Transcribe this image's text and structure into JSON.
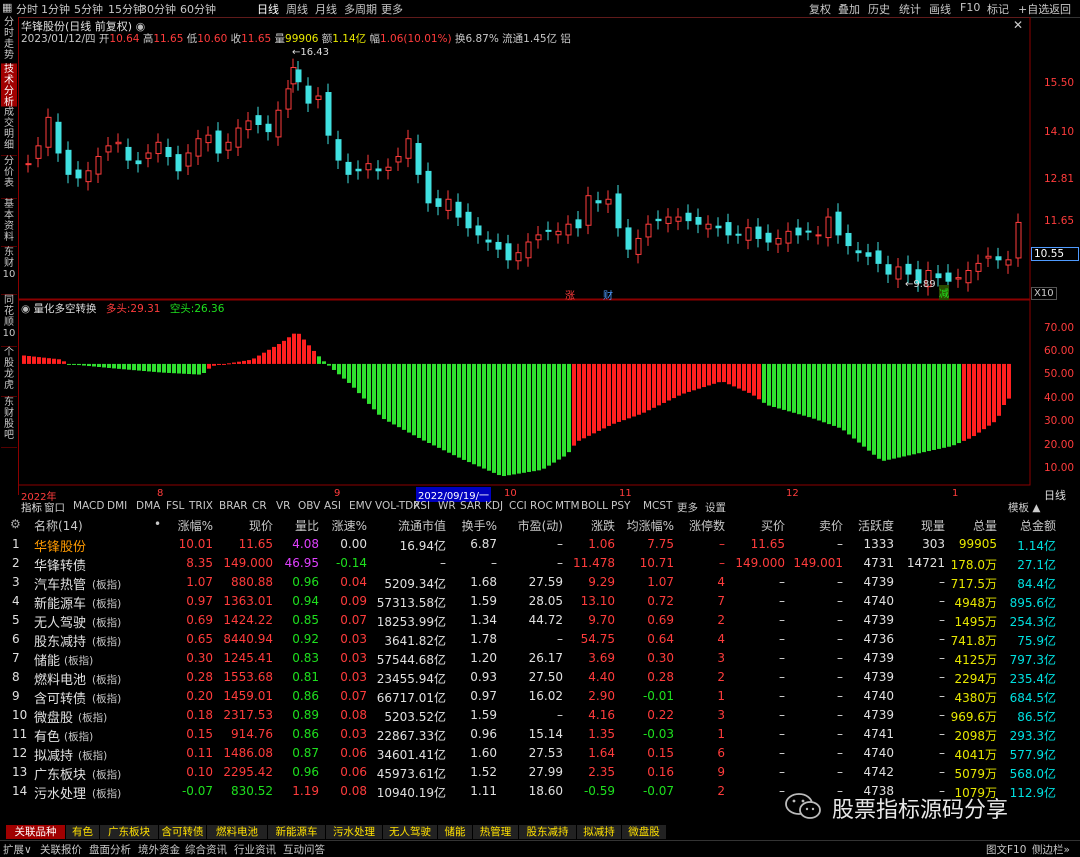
{
  "topbar": {
    "periods": [
      "分时",
      "1分钟",
      "5分钟",
      "15分钟",
      "30分钟",
      "60分钟",
      "日线",
      "周线",
      "月线",
      "多周期",
      "更多"
    ],
    "active": "日线",
    "right": [
      "复权",
      "叠加",
      "历史",
      "统计",
      "画线",
      "F10",
      "标记",
      "+自选",
      "返回"
    ]
  },
  "leftnav": {
    "tabs": [
      "分时走势",
      "技术分析",
      "成交明细",
      "分价表",
      "基本资料",
      "东财10",
      "同花顺10",
      "个股龙虎",
      "东财股吧"
    ],
    "active": "技术分析"
  },
  "kline": {
    "title": "华锋股份(日线 前复权)",
    "info_date": "2023/01/12/四",
    "info_open_label": "开",
    "info_open": "10.64",
    "info_high_label": "高",
    "info_high": "11.65",
    "info_low_label": "低",
    "info_low": "10.60",
    "info_close_label": "收",
    "info_close": "11.65",
    "info_vol_label": "量",
    "info_vol": "99906",
    "info_amt_label": "额",
    "info_amt": "1.14亿",
    "info_chg_label": "幅",
    "info_chg": "1.06(10.01%)",
    "info_turn": "换6.87%",
    "info_float": "流通1.45亿",
    "info_extra": "铝",
    "max_label": "16.43",
    "min_label": "9.89",
    "price_ticks": [
      "15.50",
      "14.10",
      "12.81",
      "11.65"
    ],
    "current_price": "10.55",
    "zoom_label": "X10",
    "markers": [
      {
        "text": "涨",
        "color": "#ff3c3c"
      },
      {
        "text": "财",
        "color": "#4f9bff"
      },
      {
        "text": "减",
        "color": "#1ee01e"
      }
    ]
  },
  "indicator": {
    "name": "量化多空转换",
    "long_label": "多头:",
    "long_value": "29.31",
    "short_label": "空头:",
    "short_value": "26.36",
    "ticks": [
      "70.00",
      "60.00",
      "50.00",
      "40.00",
      "30.00",
      "20.00",
      "10.00"
    ]
  },
  "timeaxis": {
    "labels": [
      "2022年",
      "8",
      "9",
      "2022/09/19/一",
      "10",
      "11",
      "12",
      "1"
    ],
    "period": "日线"
  },
  "indicator_tabs": [
    "指标",
    "窗口",
    "MACD",
    "DMI",
    "DMA",
    "FSL",
    "TRIX",
    "BRAR",
    "CR",
    "VR",
    "OBV",
    "ASI",
    "EMV",
    "VOL-TDX",
    "RSI",
    "WR",
    "SAR",
    "KDJ",
    "CCI",
    "ROC",
    "MTM",
    "BOLL",
    "PSY",
    "MCST",
    "更多",
    "设置"
  ],
  "template_label": "模板",
  "table": {
    "headers": [
      "名称(14)",
      "•",
      "涨幅%",
      "现价",
      "量比",
      "涨速%",
      "流通市值",
      "换手%",
      "市盈(动)",
      "涨跌",
      "均涨幅%",
      "涨停数",
      "买价",
      "卖价",
      "活跃度",
      "现量",
      "总量",
      "总金额"
    ],
    "rows": [
      {
        "no": "1",
        "name": "华锋股份",
        "tag": "",
        "chg": "10.01",
        "price": "11.65",
        "lb": "4.08",
        "speed": "0.00",
        "mcap": "16.94亿",
        "turn": "6.87",
        "pe": "–",
        "diff": "1.06",
        "avg": "7.75",
        "limit": "–",
        "buy": "11.65",
        "sell": "–",
        "act": "1333",
        "cur": "303",
        "vol": "99905",
        "amt": "1.14亿",
        "name_color": "#ff9a00",
        "chg_color": "#ff3c3c",
        "price_color": "#ff3c3c",
        "lb_color": "#e040ff",
        "speed_color": "#e0e0e0",
        "diff_color": "#ff3c3c",
        "avg_color": "#ff3c3c",
        "buy_color": "#ff3c3c",
        "vol_color": "#e8e800",
        "amt_color": "#00e0e0"
      },
      {
        "no": "2",
        "name": "华锋转债",
        "tag": "",
        "chg": "8.35",
        "price": "149.000",
        "lb": "46.95",
        "speed": "-0.14",
        "mcap": "–",
        "turn": "–",
        "pe": "–",
        "diff": "11.478",
        "avg": "10.71",
        "limit": "–",
        "buy": "149.000",
        "sell": "149.001",
        "act": "4731",
        "cur": "14721",
        "vol": "178.0万",
        "amt": "27.1亿",
        "name_color": "#e0e0e0",
        "chg_color": "#ff3c3c",
        "price_color": "#ff3c3c",
        "lb_color": "#e040ff",
        "speed_color": "#1ee01e",
        "diff_color": "#ff3c3c",
        "avg_color": "#ff3c3c",
        "buy_color": "#ff3c3c",
        "vol_color": "#e8e800",
        "amt_color": "#00e0e0"
      },
      {
        "no": "3",
        "name": "汽车热管",
        "tag": "(板指)",
        "chg": "1.07",
        "price": "880.88",
        "lb": "0.96",
        "speed": "0.04",
        "mcap": "5209.34亿",
        "turn": "1.68",
        "pe": "27.59",
        "diff": "9.29",
        "avg": "1.07",
        "limit": "4",
        "buy": "–",
        "sell": "–",
        "act": "4739",
        "cur": "–",
        "vol": "717.5万",
        "amt": "84.4亿",
        "name_color": "#e0e0e0",
        "chg_color": "#ff3c3c",
        "price_color": "#ff3c3c",
        "lb_color": "#1ee01e",
        "speed_color": "#ff3c3c",
        "diff_color": "#ff3c3c",
        "avg_color": "#ff3c3c",
        "buy_color": "#e0e0e0",
        "vol_color": "#e8e800",
        "amt_color": "#00e0e0"
      },
      {
        "no": "4",
        "name": "新能源车",
        "tag": "(板指)",
        "chg": "0.97",
        "price": "1363.01",
        "lb": "0.94",
        "speed": "0.09",
        "mcap": "57313.58亿",
        "turn": "1.59",
        "pe": "28.05",
        "diff": "13.10",
        "avg": "0.72",
        "limit": "7",
        "buy": "–",
        "sell": "–",
        "act": "4740",
        "cur": "–",
        "vol": "4948万",
        "amt": "895.6亿",
        "name_color": "#e0e0e0",
        "chg_color": "#ff3c3c",
        "price_color": "#ff3c3c",
        "lb_color": "#1ee01e",
        "speed_color": "#ff3c3c",
        "diff_color": "#ff3c3c",
        "avg_color": "#ff3c3c",
        "buy_color": "#e0e0e0",
        "vol_color": "#e8e800",
        "amt_color": "#00e0e0"
      },
      {
        "no": "5",
        "name": "无人驾驶",
        "tag": "(板指)",
        "chg": "0.69",
        "price": "1424.22",
        "lb": "0.85",
        "speed": "0.07",
        "mcap": "18253.99亿",
        "turn": "1.34",
        "pe": "44.72",
        "diff": "9.70",
        "avg": "0.69",
        "limit": "2",
        "buy": "–",
        "sell": "–",
        "act": "4739",
        "cur": "–",
        "vol": "1495万",
        "amt": "254.3亿",
        "name_color": "#e0e0e0",
        "chg_color": "#ff3c3c",
        "price_color": "#ff3c3c",
        "lb_color": "#1ee01e",
        "speed_color": "#ff3c3c",
        "diff_color": "#ff3c3c",
        "avg_color": "#ff3c3c",
        "buy_color": "#e0e0e0",
        "vol_color": "#e8e800",
        "amt_color": "#00e0e0"
      },
      {
        "no": "6",
        "name": "股东减持",
        "tag": "(板指)",
        "chg": "0.65",
        "price": "8440.94",
        "lb": "0.92",
        "speed": "0.03",
        "mcap": "3641.82亿",
        "turn": "1.78",
        "pe": "–",
        "diff": "54.75",
        "avg": "0.64",
        "limit": "4",
        "buy": "–",
        "sell": "–",
        "act": "4736",
        "cur": "–",
        "vol": "741.8万",
        "amt": "75.9亿",
        "name_color": "#e0e0e0",
        "chg_color": "#ff3c3c",
        "price_color": "#ff3c3c",
        "lb_color": "#1ee01e",
        "speed_color": "#ff3c3c",
        "diff_color": "#ff3c3c",
        "avg_color": "#ff3c3c",
        "buy_color": "#e0e0e0",
        "vol_color": "#e8e800",
        "amt_color": "#00e0e0"
      },
      {
        "no": "7",
        "name": "储能",
        "tag": "(板指)",
        "chg": "0.30",
        "price": "1245.41",
        "lb": "0.83",
        "speed": "0.03",
        "mcap": "57544.68亿",
        "turn": "1.20",
        "pe": "26.17",
        "diff": "3.69",
        "avg": "0.30",
        "limit": "3",
        "buy": "–",
        "sell": "–",
        "act": "4739",
        "cur": "–",
        "vol": "4125万",
        "amt": "797.3亿",
        "name_color": "#e0e0e0",
        "chg_color": "#ff3c3c",
        "price_color": "#ff3c3c",
        "lb_color": "#1ee01e",
        "speed_color": "#ff3c3c",
        "diff_color": "#ff3c3c",
        "avg_color": "#ff3c3c",
        "buy_color": "#e0e0e0",
        "vol_color": "#e8e800",
        "amt_color": "#00e0e0"
      },
      {
        "no": "8",
        "name": "燃料电池",
        "tag": "(板指)",
        "chg": "0.28",
        "price": "1553.68",
        "lb": "0.81",
        "speed": "0.03",
        "mcap": "23455.94亿",
        "turn": "0.93",
        "pe": "27.50",
        "diff": "4.40",
        "avg": "0.28",
        "limit": "2",
        "buy": "–",
        "sell": "–",
        "act": "4739",
        "cur": "–",
        "vol": "2294万",
        "amt": "235.4亿",
        "name_color": "#e0e0e0",
        "chg_color": "#ff3c3c",
        "price_color": "#ff3c3c",
        "lb_color": "#1ee01e",
        "speed_color": "#ff3c3c",
        "diff_color": "#ff3c3c",
        "avg_color": "#ff3c3c",
        "buy_color": "#e0e0e0",
        "vol_color": "#e8e800",
        "amt_color": "#00e0e0"
      },
      {
        "no": "9",
        "name": "含可转债",
        "tag": "(板指)",
        "chg": "0.20",
        "price": "1459.01",
        "lb": "0.86",
        "speed": "0.07",
        "mcap": "66717.01亿",
        "turn": "0.97",
        "pe": "16.02",
        "diff": "2.90",
        "avg": "-0.01",
        "limit": "1",
        "buy": "–",
        "sell": "–",
        "act": "4740",
        "cur": "–",
        "vol": "4380万",
        "amt": "684.5亿",
        "name_color": "#e0e0e0",
        "chg_color": "#ff3c3c",
        "price_color": "#ff3c3c",
        "lb_color": "#1ee01e",
        "speed_color": "#ff3c3c",
        "diff_color": "#ff3c3c",
        "avg_color": "#1ee01e",
        "buy_color": "#e0e0e0",
        "vol_color": "#e8e800",
        "amt_color": "#00e0e0"
      },
      {
        "no": "10",
        "name": "微盘股",
        "tag": "(板指)",
        "chg": "0.18",
        "price": "2317.53",
        "lb": "0.89",
        "speed": "0.08",
        "mcap": "5203.52亿",
        "turn": "1.59",
        "pe": "–",
        "diff": "4.16",
        "avg": "0.22",
        "limit": "3",
        "buy": "–",
        "sell": "–",
        "act": "4739",
        "cur": "–",
        "vol": "969.6万",
        "amt": "86.5亿",
        "name_color": "#e0e0e0",
        "chg_color": "#ff3c3c",
        "price_color": "#ff3c3c",
        "lb_color": "#1ee01e",
        "speed_color": "#ff3c3c",
        "diff_color": "#ff3c3c",
        "avg_color": "#ff3c3c",
        "buy_color": "#e0e0e0",
        "vol_color": "#e8e800",
        "amt_color": "#00e0e0"
      },
      {
        "no": "11",
        "name": "有色",
        "tag": "(板指)",
        "chg": "0.15",
        "price": "914.76",
        "lb": "0.86",
        "speed": "0.03",
        "mcap": "22867.33亿",
        "turn": "0.96",
        "pe": "15.14",
        "diff": "1.35",
        "avg": "-0.03",
        "limit": "1",
        "buy": "–",
        "sell": "–",
        "act": "4741",
        "cur": "–",
        "vol": "2098万",
        "amt": "293.3亿",
        "name_color": "#e0e0e0",
        "chg_color": "#ff3c3c",
        "price_color": "#ff3c3c",
        "lb_color": "#1ee01e",
        "speed_color": "#ff3c3c",
        "diff_color": "#ff3c3c",
        "avg_color": "#1ee01e",
        "buy_color": "#e0e0e0",
        "vol_color": "#e8e800",
        "amt_color": "#00e0e0"
      },
      {
        "no": "12",
        "name": "拟减持",
        "tag": "(板指)",
        "chg": "0.11",
        "price": "1486.08",
        "lb": "0.87",
        "speed": "0.06",
        "mcap": "34601.41亿",
        "turn": "1.60",
        "pe": "27.53",
        "diff": "1.64",
        "avg": "0.15",
        "limit": "6",
        "buy": "–",
        "sell": "–",
        "act": "4740",
        "cur": "–",
        "vol": "4041万",
        "amt": "577.9亿",
        "name_color": "#e0e0e0",
        "chg_color": "#ff3c3c",
        "price_color": "#ff3c3c",
        "lb_color": "#1ee01e",
        "speed_color": "#ff3c3c",
        "diff_color": "#ff3c3c",
        "avg_color": "#ff3c3c",
        "buy_color": "#e0e0e0",
        "vol_color": "#e8e800",
        "amt_color": "#00e0e0"
      },
      {
        "no": "13",
        "name": "广东板块",
        "tag": "(板指)",
        "chg": "0.10",
        "price": "2295.42",
        "lb": "0.96",
        "speed": "0.06",
        "mcap": "45973.61亿",
        "turn": "1.52",
        "pe": "27.99",
        "diff": "2.35",
        "avg": "0.16",
        "limit": "9",
        "buy": "–",
        "sell": "–",
        "act": "4742",
        "cur": "–",
        "vol": "5079万",
        "amt": "568.0亿",
        "name_color": "#e0e0e0",
        "chg_color": "#ff3c3c",
        "price_color": "#ff3c3c",
        "lb_color": "#1ee01e",
        "speed_color": "#ff3c3c",
        "diff_color": "#ff3c3c",
        "avg_color": "#ff3c3c",
        "buy_color": "#e0e0e0",
        "vol_color": "#e8e800",
        "amt_color": "#00e0e0"
      },
      {
        "no": "14",
        "name": "污水处理",
        "tag": "(板指)",
        "chg": "-0.07",
        "price": "830.52",
        "lb": "1.19",
        "speed": "0.08",
        "mcap": "10940.19亿",
        "turn": "1.11",
        "pe": "18.60",
        "diff": "-0.59",
        "avg": "-0.07",
        "limit": "2",
        "buy": "–",
        "sell": "–",
        "act": "4738",
        "cur": "–",
        "vol": "1079万",
        "amt": "112.9亿",
        "name_color": "#e0e0e0",
        "chg_color": "#1ee01e",
        "price_color": "#1ee01e",
        "lb_color": "#ff3c3c",
        "speed_color": "#ff3c3c",
        "diff_color": "#1ee01e",
        "avg_color": "#1ee01e",
        "buy_color": "#e0e0e0",
        "vol_color": "#e8e800",
        "amt_color": "#00e0e0"
      }
    ]
  },
  "watermark": "股票指标源码分享",
  "bottomtabs": [
    "关联品种",
    "有色",
    "广东板块",
    "含可转债",
    "燃料电池",
    "新能源车",
    "污水处理",
    "无人驾驶",
    "储能",
    "热管理",
    "股东减持",
    "拟减持",
    "微盘股"
  ],
  "statusbar": {
    "items": [
      "扩展∨",
      "关联报价",
      "盘面分析",
      "境外资金",
      "综合资讯",
      "行业资讯",
      "互动问答"
    ],
    "right": [
      "图文F10",
      "侧边栏»"
    ]
  },
  "chart_data": [
    {
      "type": "candlestick",
      "title": "华锋股份(日线 前复权)",
      "y_ticks": [
        "15.50",
        "14.10",
        "12.81",
        "11.65"
      ],
      "high": 16.43,
      "low": 9.89,
      "last": 11.65
    },
    {
      "type": "bar",
      "title": "量化多空转换",
      "series": [
        {
          "name": "多头",
          "values": [
            29.31
          ]
        },
        {
          "name": "空头",
          "values": [
            26.36
          ]
        }
      ],
      "ylim": [
        0,
        75
      ]
    }
  ]
}
